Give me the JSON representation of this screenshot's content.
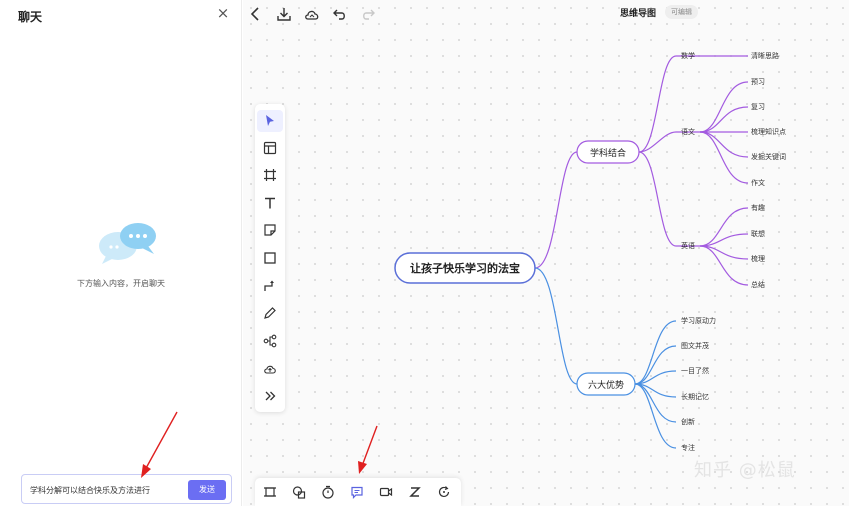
{
  "chat": {
    "title": "聊天",
    "empty_hint": "下方输入内容，开启聊天",
    "input_value": "学科分解可以结合快乐及方法进行",
    "send_label": "发送"
  },
  "toolbar": {
    "doc_title": "思维导图",
    "doc_status": "可编辑",
    "icons": [
      "back-icon",
      "download-icon",
      "cloud-icon",
      "undo-icon",
      "redo-icon"
    ]
  },
  "side_tools": [
    "cursor-icon",
    "template-icon",
    "frame-icon",
    "text-icon",
    "sticky-note-icon",
    "rectangle-icon",
    "connector-icon",
    "pen-icon",
    "mindmap-icon",
    "upload-icon",
    "more-icon"
  ],
  "bottom_tools": [
    "frame-list-icon",
    "shapes-icon",
    "timer-icon",
    "comment-icon",
    "video-icon",
    "z-icon",
    "refresh-icon"
  ],
  "mindmap": {
    "root": "让孩子快乐学习的法宝",
    "branch1": {
      "label": "学科结合",
      "subjects": [
        {
          "label": "数学",
          "children": [
            "清晰思路"
          ]
        },
        {
          "label": "语文",
          "children": [
            "预习",
            "复习",
            "梳理知识点",
            "发掘关键词",
            "作文"
          ]
        },
        {
          "label": "英语",
          "children": [
            "有趣",
            "联想",
            "梳理",
            "总结"
          ]
        }
      ]
    },
    "branch2": {
      "label": "六大优势",
      "children": [
        "学习原动力",
        "图文并茂",
        "一目了然",
        "长期记忆",
        "创新",
        "专注"
      ]
    }
  },
  "watermark": "知乎 @松鼠",
  "colors": {
    "purple": "#a35be0",
    "blue": "#4a90e2",
    "accent": "#6b6ef3"
  }
}
